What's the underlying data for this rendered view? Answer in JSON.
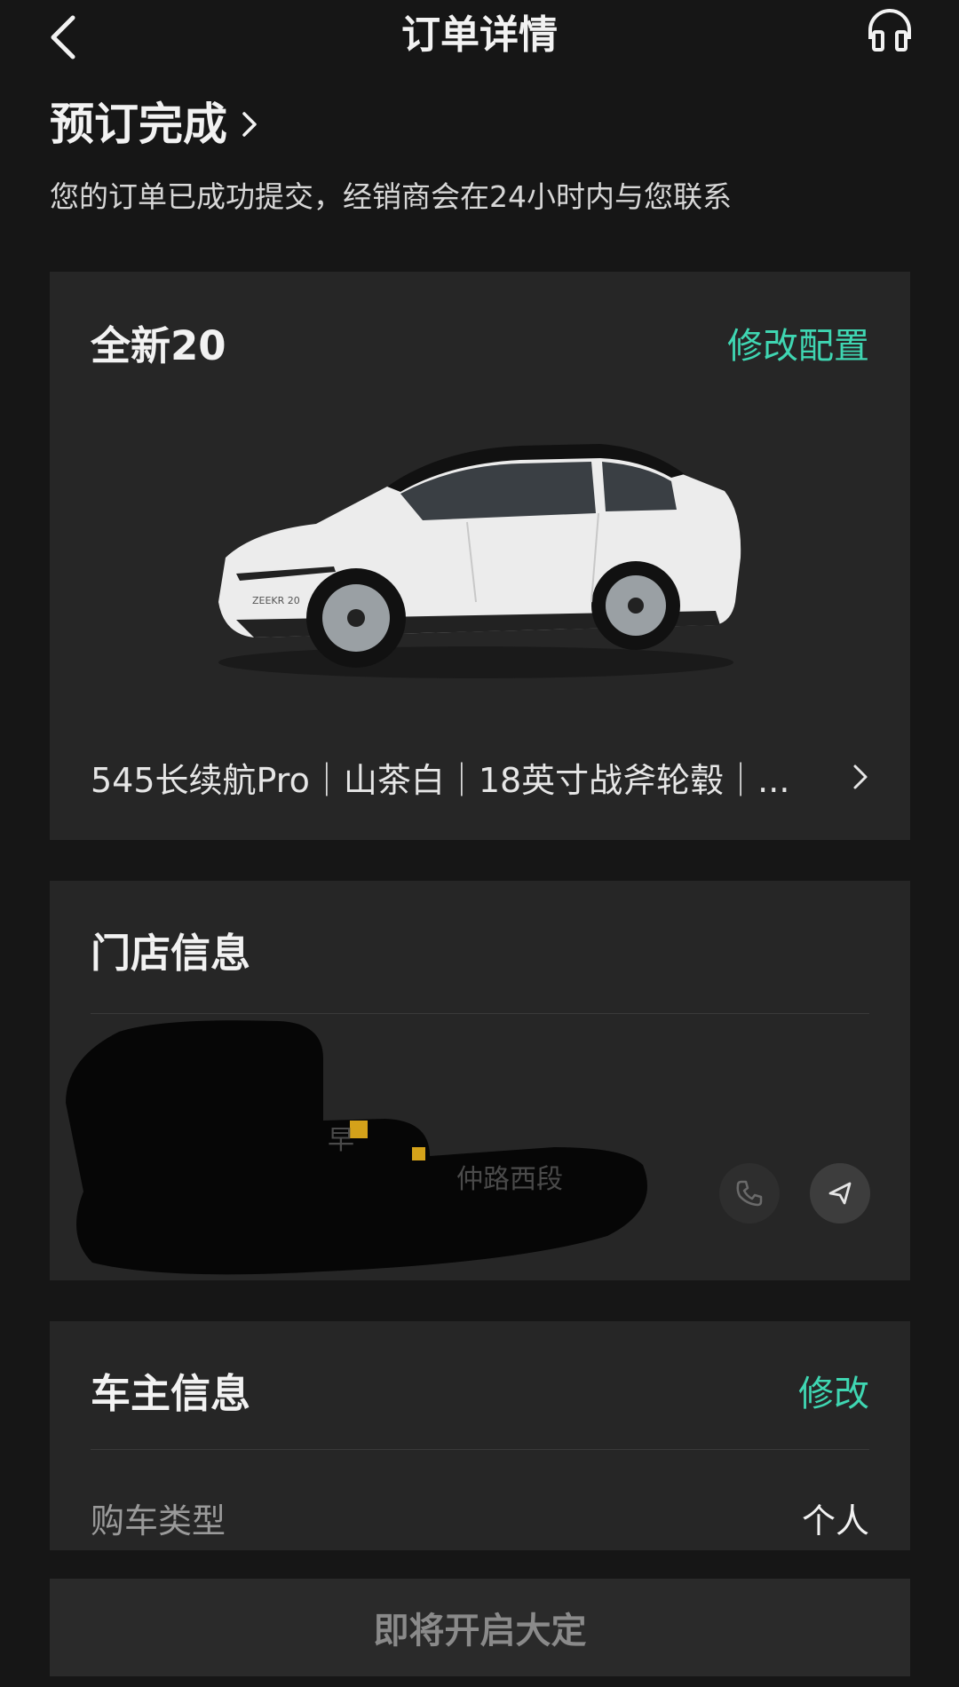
{
  "header": {
    "title": "订单详情",
    "back_icon": "back-chevron-icon",
    "service_icon": "headset-icon"
  },
  "status": {
    "title": "预订完成",
    "description": "您的订单已成功提交，经销商会在24小时内与您联系"
  },
  "car_card": {
    "model_name": "全新20",
    "modify_label": "修改配置",
    "config_summary": "545长续航Pro｜山茶白｜18英寸战斧轮毂｜...",
    "image_badge": "ZEEKR 20"
  },
  "store_card": {
    "title": "门店信息",
    "partial_text_1": "早",
    "partial_text_2": "仲路西段",
    "phone_icon": "phone-icon",
    "navigate_icon": "navigation-arrow-icon"
  },
  "owner_card": {
    "title": "车主信息",
    "modify_label": "修改",
    "purchase_type_label": "购车类型",
    "purchase_type_value": "个人"
  },
  "bottom_button": {
    "label": "即将开启大定"
  },
  "colors": {
    "background": "#161616",
    "card": "#262626",
    "accent": "#3fd6b2",
    "muted_text": "#9a9a9a"
  }
}
